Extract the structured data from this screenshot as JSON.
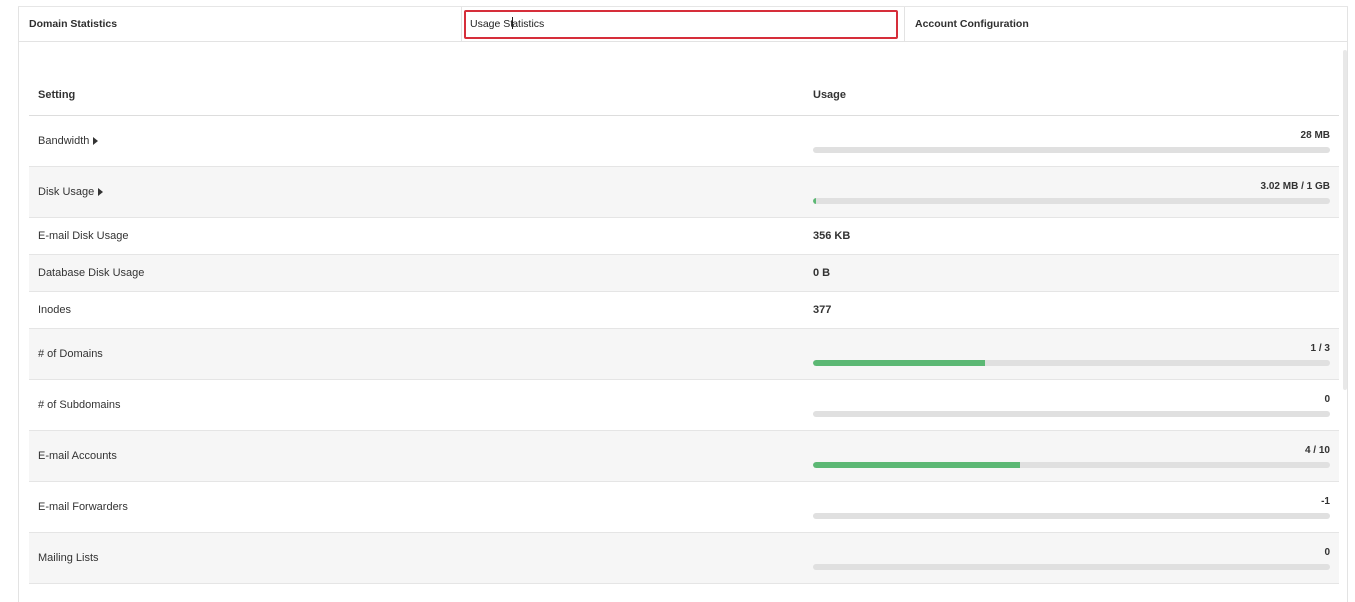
{
  "tabs": [
    {
      "label": "Domain Statistics",
      "active": false
    },
    {
      "label_before_cursor": "Usage St",
      "label_after_cursor": "atistics",
      "highlighted": true
    },
    {
      "label": "Account Configuration",
      "active": false
    }
  ],
  "table": {
    "headers": {
      "setting": "Setting",
      "usage": "Usage"
    },
    "rows": [
      {
        "setting": "Bandwidth",
        "expandable": true,
        "usage": "28 MB",
        "has_bar": true,
        "fill_fraction": 0
      },
      {
        "setting": "Disk Usage",
        "expandable": true,
        "usage": "3.02 MB / 1 GB",
        "has_bar": true,
        "fill_fraction": 0.003
      },
      {
        "setting": "E-mail Disk Usage",
        "expandable": false,
        "usage": "356 KB",
        "has_bar": false
      },
      {
        "setting": "Database Disk Usage",
        "expandable": false,
        "usage": "0 B",
        "has_bar": false
      },
      {
        "setting": "Inodes",
        "expandable": false,
        "usage": "377",
        "has_bar": false
      },
      {
        "setting": "# of Domains",
        "expandable": false,
        "usage": "1 / 3",
        "has_bar": true,
        "fill_fraction": 0.333
      },
      {
        "setting": "# of Subdomains",
        "expandable": false,
        "usage": "0",
        "has_bar": true,
        "fill_fraction": 0
      },
      {
        "setting": "E-mail Accounts",
        "expandable": false,
        "usage": "4 / 10",
        "has_bar": true,
        "fill_fraction": 0.4
      },
      {
        "setting": "E-mail Forwarders",
        "expandable": false,
        "usage": "-1",
        "has_bar": true,
        "fill_fraction": 0
      },
      {
        "setting": "Mailing Lists",
        "expandable": false,
        "usage": "0",
        "has_bar": true,
        "fill_fraction": 0
      }
    ]
  },
  "colors": {
    "bar_fill": "#5cb874",
    "bar_track": "#e0e0e0",
    "highlight_border": "#d62e3a"
  }
}
